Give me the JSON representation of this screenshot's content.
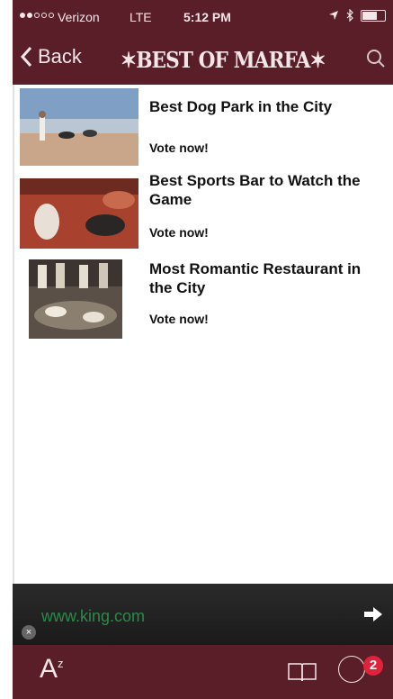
{
  "status_bar": {
    "carrier": "Verizon",
    "network": "LTE",
    "time": "5:12 PM"
  },
  "nav": {
    "back_label": "Back",
    "title": "✶BEST OF MARFA✶"
  },
  "items": [
    {
      "title": "Best Dog Park in the City",
      "action": "Vote now!"
    },
    {
      "title": "Best Sports Bar to Watch the Game",
      "action": "Vote now!"
    },
    {
      "title": "Most Romantic Restaurant in the City",
      "action": "Vote now!"
    }
  ],
  "ad": {
    "url": "www.king.com",
    "close": "×"
  },
  "toolbar": {
    "az_label": "A",
    "az_sup": "z",
    "badge_count": "2"
  },
  "colors": {
    "brand": "#5a1e28",
    "badge": "#e0233a",
    "ad_text": "#2a8b48"
  },
  "icons": {
    "back": "chevron-left-icon",
    "search": "search-icon",
    "book": "book-icon",
    "chat": "chat-bubble-icon",
    "ad_arrow": "arrow-right-icon"
  }
}
